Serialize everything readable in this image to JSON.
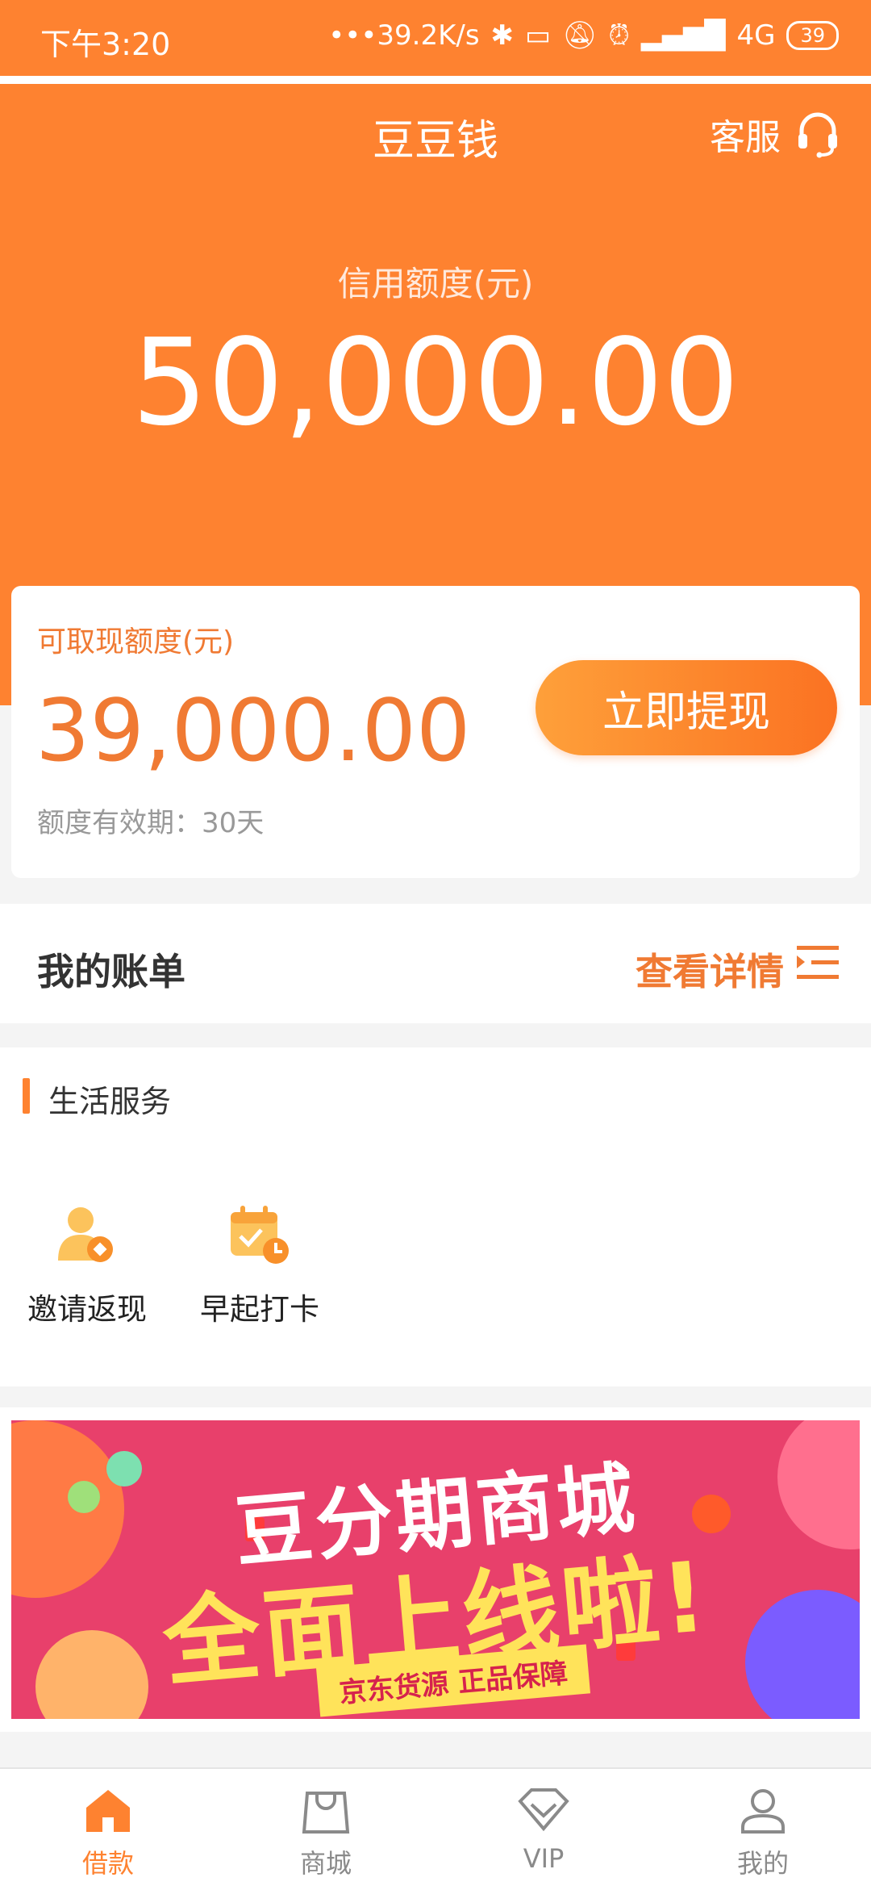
{
  "status_bar": {
    "time": "下午3:20",
    "speed": "•••39.2K/s",
    "network": "4G",
    "battery": "39"
  },
  "header": {
    "title": "豆豆钱",
    "customer_service": "客服",
    "credit_label": "信用额度(元)",
    "credit_amount": "50,000.00"
  },
  "withdraw_card": {
    "label": "可取现额度(元)",
    "amount": "39,000.00",
    "validity": "额度有效期：30天",
    "button": "立即提现"
  },
  "bills": {
    "title": "我的账单",
    "link": "查看详情"
  },
  "life_services": {
    "title": "生活服务",
    "items": [
      {
        "label": "邀请返现",
        "icon": "invite-cashback-icon"
      },
      {
        "label": "早起打卡",
        "icon": "calendar-checkin-icon"
      }
    ]
  },
  "banner": {
    "line1": "豆分期商城",
    "line2": "全面上线啦!",
    "sub": "京东货源 正品保障"
  },
  "bottom_nav": [
    {
      "label": "借款",
      "icon": "home-icon",
      "active": true
    },
    {
      "label": "商城",
      "icon": "shopping-bag-icon",
      "active": false
    },
    {
      "label": "VIP",
      "icon": "diamond-icon",
      "active": false
    },
    {
      "label": "我的",
      "icon": "profile-icon",
      "active": false
    }
  ],
  "colors": {
    "primary": "#fe8230",
    "accent_text": "#f07a33",
    "nav_inactive": "#8a8a8a"
  }
}
